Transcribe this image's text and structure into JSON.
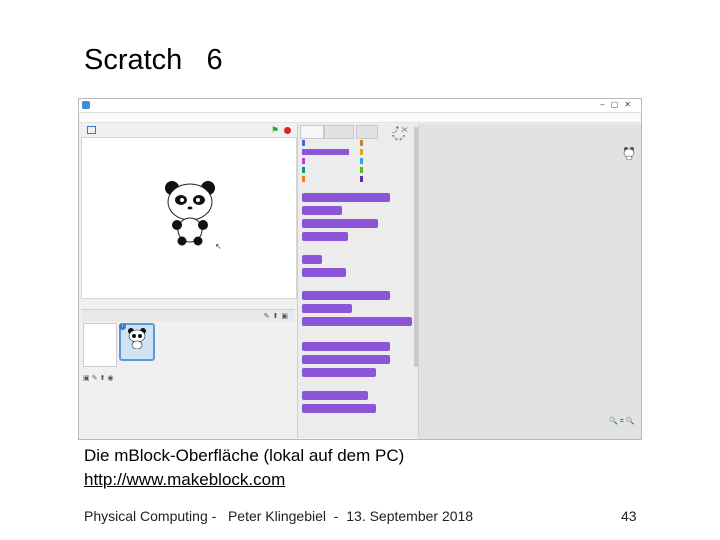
{
  "slide": {
    "title": "Scratch   6",
    "caption": "Die mBlock-Oberfläche (lokal auf dem PC)",
    "link": "http://www.makeblock.com",
    "footer": "Physical Computing -   Peter Klingebiel  -  13. September 2018",
    "page_number": "43"
  },
  "colors": {
    "looks_block": "#8a55d7",
    "green_flag": "#2aa12a",
    "stop": "#e02020",
    "sprite_selected": "#5b9ad4"
  }
}
